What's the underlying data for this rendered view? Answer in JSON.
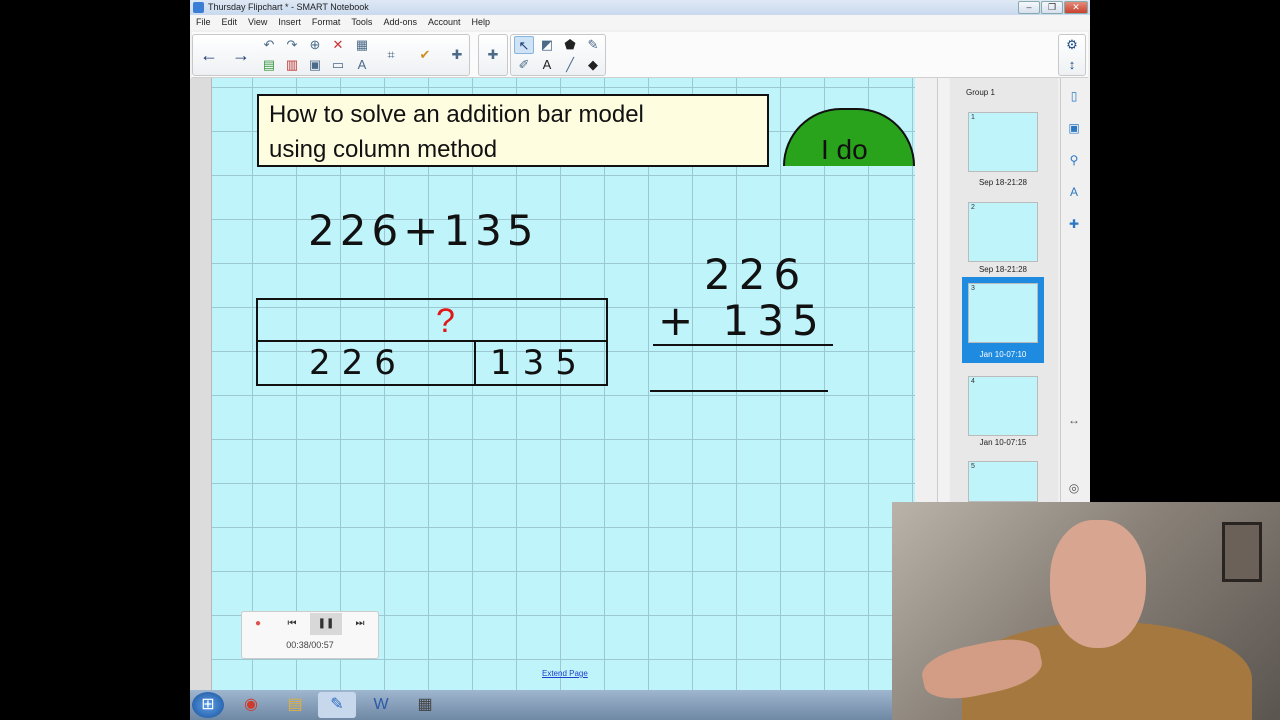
{
  "window": {
    "title": "Thursday Flipchart * - SMART Notebook"
  },
  "menu": [
    "File",
    "Edit",
    "View",
    "Insert",
    "Format",
    "Tools",
    "Add-ons",
    "Account",
    "Help"
  ],
  "slide": {
    "title_line1": "How to solve an addition bar model",
    "title_line2": "using column method",
    "badge": "I do",
    "equation": "226+135",
    "bar_top": "?",
    "bar_left": "226",
    "bar_right": "135",
    "column_top": "226",
    "column_mid": "+ 135",
    "extend_link": "Extend Page"
  },
  "player": {
    "time": "00:38/00:57"
  },
  "sorter": {
    "group": "Group 1",
    "slides": [
      {
        "num": "1",
        "caption": "Sep 18-21:28"
      },
      {
        "num": "2",
        "caption": "Sep 18-21:28"
      },
      {
        "num": "3",
        "caption": "Jan 10-07:10"
      },
      {
        "num": "4",
        "caption": "Jan 10-07:15"
      },
      {
        "num": "5",
        "caption": ""
      }
    ]
  },
  "colors": {
    "canvas": "#c0f4fb",
    "badge": "#2aa31c",
    "question": "#e01818",
    "selected": "#1e8ae0"
  }
}
